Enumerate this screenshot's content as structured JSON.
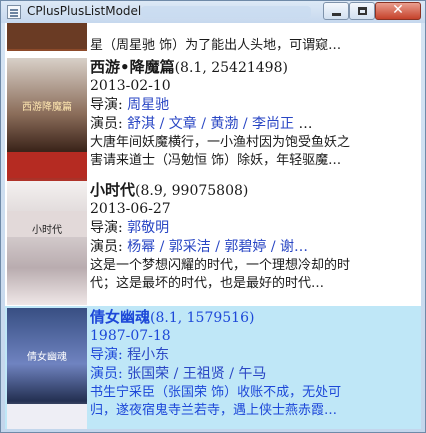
{
  "window": {
    "title": "CPlusPlusListModel",
    "controls": {
      "minimize": "minimize",
      "maximize": "maximize",
      "close": "close"
    }
  },
  "items": [
    {
      "desc": "星（周星驰 饰）为了能出人头地，可谓窥…"
    },
    {
      "title": "西游•降魔篇",
      "meta": "(8.1, 25421498)",
      "date": "2013-02-10",
      "director_label": "导演:",
      "director": "周星驰",
      "actor_label": "演员:",
      "actors": [
        "舒淇",
        "文章",
        "黄渤",
        "李尚正"
      ],
      "actors_more": "…",
      "desc1": "大唐年间妖魔横行，一小渔村因为饱受鱼妖之",
      "desc2": "害请来道士（冯勉恒 饰）除妖，年轻驱魔…",
      "poster_text": "西游降魔篇"
    },
    {
      "title": "小时代",
      "meta": "(8.9, 99075808)",
      "date": "2013-06-27",
      "director_label": "导演:",
      "director": "郭敬明",
      "actor_label": "演员:",
      "actors": [
        "杨幂",
        "郭采洁",
        "郭碧婷",
        "谢…"
      ],
      "desc1": "这是一个梦想闪耀的时代，一个理想冷却的时",
      "desc2": "代；这是最坏的时代，也是最好的时代…",
      "poster_text": "小时代"
    },
    {
      "title": "倩女幽魂",
      "meta": "(8.1, 1579516)",
      "date": "1987-07-18",
      "director_label": "导演:",
      "director": "程小东",
      "actor_label": "演员:",
      "actors": [
        "张国荣",
        "王祖贤",
        "午马"
      ],
      "desc1": "书生宁采臣（张国荣 饰）收账不成，无处可",
      "desc2": "归，遂夜宿鬼寺兰若寺，遇上侠士燕赤霞…",
      "poster_text": "倩女幽魂"
    }
  ],
  "separator": " / "
}
